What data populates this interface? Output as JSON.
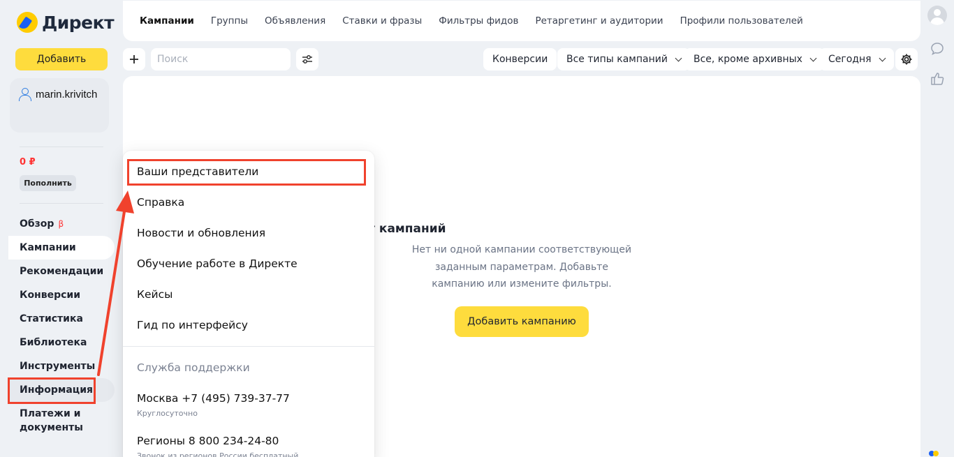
{
  "brand": {
    "name": "Директ"
  },
  "sidebar": {
    "add_label": "Добавить",
    "username": "marin.krivitch",
    "balance": "0 ₽",
    "topup_label": "Пополнить",
    "beta_mark": "β",
    "items": [
      {
        "label": "Обзор"
      },
      {
        "label": "Кампании"
      },
      {
        "label": "Рекомендации"
      },
      {
        "label": "Конверсии"
      },
      {
        "label": "Статистика"
      },
      {
        "label": "Библиотека"
      },
      {
        "label": "Инструменты"
      },
      {
        "label": "Информация"
      },
      {
        "label": "Платежи и документы"
      }
    ]
  },
  "tabs": [
    {
      "label": "Кампании"
    },
    {
      "label": "Группы"
    },
    {
      "label": "Объявления"
    },
    {
      "label": "Ставки и фразы"
    },
    {
      "label": "Фильтры фидов"
    },
    {
      "label": "Ретаргетинг и аудитории"
    },
    {
      "label": "Профили пользователей"
    }
  ],
  "toolbar": {
    "search_placeholder": "Поиск",
    "conversions_label": "Конверсии",
    "campaign_types_label": "Все типы кампаний",
    "archive_filter_label": "Все, кроме архивных",
    "period_label": "Сегодня"
  },
  "empty_state": {
    "title": "Нет кампаний",
    "text": "Нет ни одной кампании соответствующей заданным параметрам. Добавьте кампанию или измените фильтры.",
    "button_label": "Добавить кампанию"
  },
  "info_menu": {
    "items": [
      {
        "label": "Ваши представители"
      },
      {
        "label": "Справка"
      },
      {
        "label": "Новости и обновления"
      },
      {
        "label": "Обучение работе в Директе"
      },
      {
        "label": "Кейсы"
      },
      {
        "label": "Гид по интерфейсу"
      }
    ],
    "support_heading": "Служба поддержки",
    "phones": [
      {
        "label": "Москва +7 (495) 739-37-77",
        "note": "Круглосуточно"
      },
      {
        "label": "Регионы 8 800 234-24-80",
        "note": "Звонок из регионов России бесплатный"
      }
    ]
  },
  "colors": {
    "accent_yellow": "#fedc3d",
    "annotation_red": "#f0422d",
    "balance_red": "#ff3333",
    "user_icon_blue": "#2f7de1"
  }
}
